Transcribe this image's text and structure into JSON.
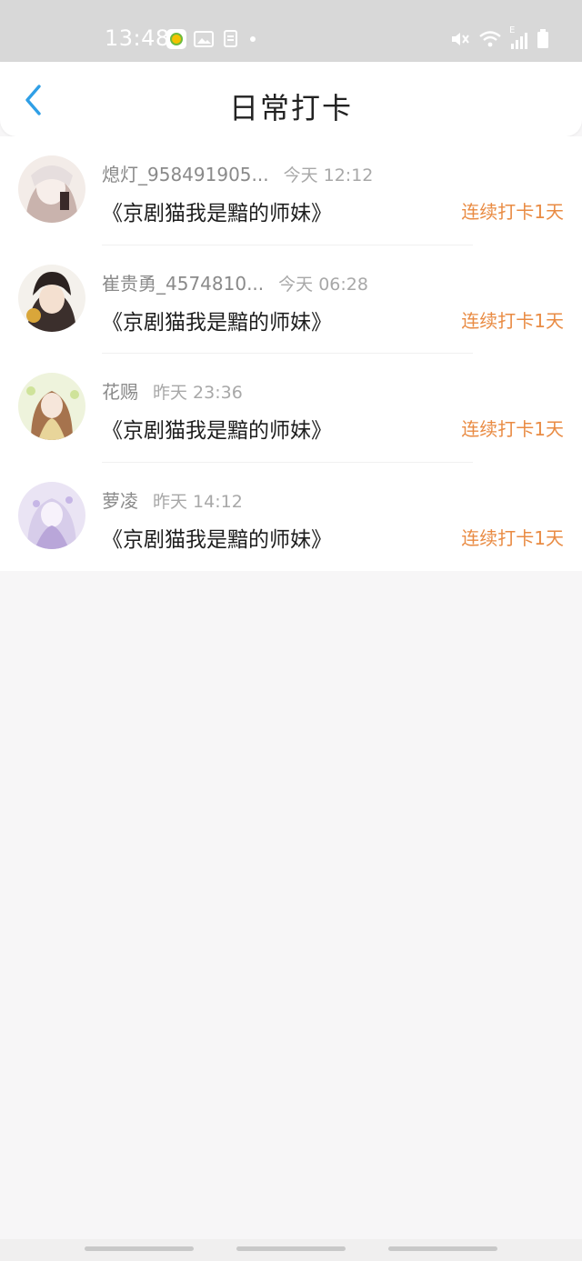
{
  "status_bar": {
    "time": "13:48",
    "notification_icons": [
      "app-notification-icon",
      "image-icon",
      "clipboard-icon",
      "dot-icon"
    ],
    "system_icons": [
      "mute-icon",
      "wifi-icon",
      "signal-icon",
      "battery-icon"
    ],
    "signal_label": "E"
  },
  "header": {
    "title": "日常打卡",
    "back_icon": "chevron-left-icon"
  },
  "checkins": [
    {
      "name": "熄灯_958491905...",
      "time": "今天 12:12",
      "book": "《京剧猫我是黯的师妹》",
      "streak": "连续打卡1天",
      "avatar_colors": [
        "#f3ece8",
        "#c9b3ad",
        "#3a2a2a"
      ]
    },
    {
      "name": "崔贵勇_4574810...",
      "time": "今天 06:28",
      "book": "《京剧猫我是黯的师妹》",
      "streak": "连续打卡1天",
      "avatar_colors": [
        "#f4f1ec",
        "#2b2220",
        "#d9a63a"
      ]
    },
    {
      "name": "花赐",
      "time": "昨天 23:36",
      "book": "《京剧猫我是黯的师妹》",
      "streak": "连续打卡1天",
      "avatar_colors": [
        "#eef3dc",
        "#a6734d",
        "#e8d59a"
      ]
    },
    {
      "name": "萝凌",
      "time": "昨天 14:12",
      "book": "《京剧猫我是黯的师妹》",
      "streak": "连续打卡1天",
      "avatar_colors": [
        "#eae4f4",
        "#b9a6d9",
        "#d7cdea"
      ]
    }
  ],
  "colors": {
    "accent_back": "#2f9fe6",
    "streak": "#e98b43",
    "status_bar_bg": "#d8d8d8",
    "page_bg": "#f7f6f7"
  }
}
